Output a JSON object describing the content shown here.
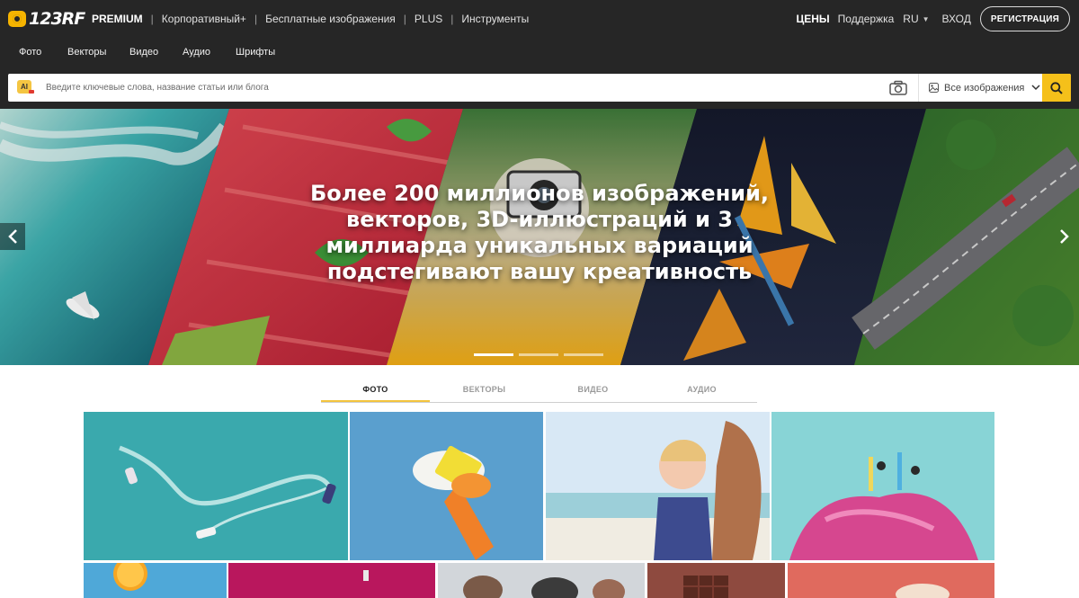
{
  "brand": {
    "logo_text": "123RF"
  },
  "topnav": {
    "premium": "PREMIUM",
    "links": [
      "Корпоративный+",
      "Бесплатные изображения",
      "PLUS",
      "Инструменты"
    ]
  },
  "topright": {
    "prices": "ЦЕНЫ",
    "support": "Поддержка",
    "language": "RU",
    "login": "ВХОД",
    "register": "РЕГИСТРАЦИЯ"
  },
  "categories": [
    "Фото",
    "Векторы",
    "Видео",
    "Аудио",
    "Шрифты"
  ],
  "search": {
    "ai_label": "AI",
    "placeholder": "Введите ключевые слова, название статьи или блога",
    "filter_label": "Все изображения",
    "icons": [
      "ai-icon",
      "camera-icon",
      "image-icon",
      "chevron-down-icon",
      "search-icon"
    ]
  },
  "hero": {
    "title_lines": [
      "Более 200 миллионов изображений,",
      "векторов, 3D-иллюстраций и 3",
      "миллиарда уникальных вариаций",
      "подстегивают вашу креативность"
    ],
    "slides": 3,
    "active_slide": 1
  },
  "tabs": [
    "ФОТО",
    "ВЕКТОРЫ",
    "ВИДЕО",
    "АУДИО"
  ],
  "active_tab": "ФОТО",
  "colors": {
    "header_bg": "#262626",
    "accent": "#f5c01a",
    "text_light": "#ffffff"
  }
}
